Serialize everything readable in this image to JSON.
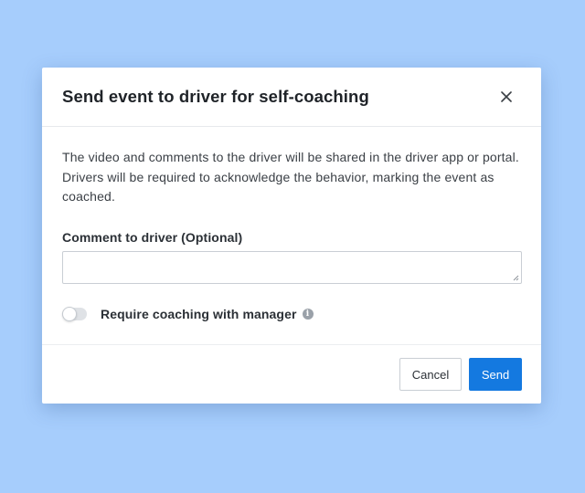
{
  "modal": {
    "title": "Send event to driver for self-coaching",
    "close_icon": "close-icon",
    "description": "The video and comments to the driver will be shared in the driver app or portal. Drivers will be required to acknowledge the behavior, marking the event as coached.",
    "comment_label": "Comment to driver (Optional)",
    "comment_value": "",
    "toggle": {
      "label": "Require coaching with manager",
      "checked": false,
      "info_icon": "info-icon",
      "info_glyph": "i"
    },
    "footer": {
      "cancel_label": "Cancel",
      "send_label": "Send"
    }
  },
  "colors": {
    "background": "#a6cdfc",
    "primary": "#1479e0",
    "toggle_off": "#dfe2e6",
    "border": "#c9ced4"
  }
}
